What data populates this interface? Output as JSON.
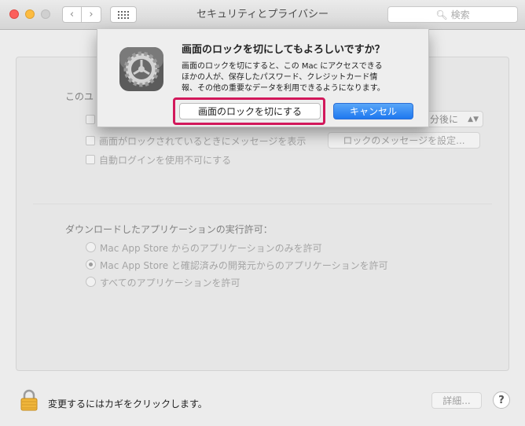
{
  "window": {
    "title": "セキュリティとプライバシー"
  },
  "toolbar": {
    "search_placeholder": "検索"
  },
  "general": {
    "section_label_visible": "このユ",
    "delay_value": "分後に",
    "show_message_label": "画面がロックされているときにメッセージを表示",
    "set_message_button": "ロックのメッセージを設定...",
    "disable_autologin_label": "自動ログインを使用不可にする"
  },
  "downloads": {
    "heading": "ダウンロードしたアプリケーションの実行許可：",
    "options": [
      {
        "label": "Mac App Store からのアプリケーションのみを許可",
        "selected": false
      },
      {
        "label": "Mac App Store と確認済みの開発元からのアプリケーションを許可",
        "selected": true
      },
      {
        "label": "すべてのアプリケーションを許可",
        "selected": false
      }
    ]
  },
  "footer": {
    "lock_text": "変更するにはカギをクリックします。",
    "advanced_button": "詳細...",
    "help_label": "?"
  },
  "dialog": {
    "title": "画面のロックを切にしてもよろしいですか？",
    "message": "画面のロックを切にすると、この Mac にアクセスできる\nほかの人が、保存したパスワード、クレジットカード情\n報、その他の重要なデータを利用できるようになります。",
    "confirm_button": "画面のロックを切にする",
    "cancel_button": "キャンセル",
    "icon": "gear-icon",
    "highlight_color": "#d2185b",
    "accent_color": "#2f8cf3"
  }
}
